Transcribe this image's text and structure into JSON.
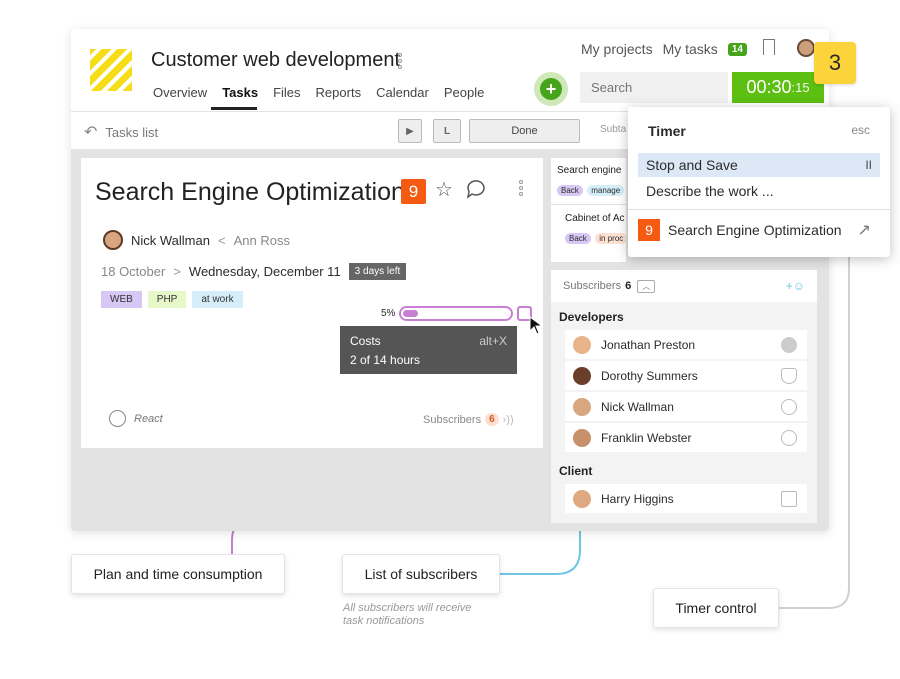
{
  "header": {
    "project_title": "Customer web development",
    "nav": [
      "Overview",
      "Tasks",
      "Files",
      "Reports",
      "Calendar",
      "People"
    ],
    "active_nav": "Tasks",
    "my_projects": "My projects",
    "my_tasks": "My tasks",
    "my_tasks_count": "14",
    "search_placeholder": "Search",
    "timer_main": "00:30",
    "timer_seconds": ":15"
  },
  "toolbar": {
    "back_label": "Tasks list",
    "play_label": "▶",
    "l_label": "L",
    "done_label": "Done",
    "subtasks_label": "Subta"
  },
  "task": {
    "title": "Search Engine Optimization",
    "number": "9",
    "assignee": "Nick Wallman",
    "separator": "<",
    "author": "Ann Ross",
    "start_date": "18 October",
    "arrow": ">",
    "due_date": "Wednesday, December 11",
    "days_left": "3 days left",
    "tags": [
      "WEB",
      "PHP",
      "at work"
    ],
    "progress_label": "5%",
    "progress": 0.14,
    "tooltip_title": "Costs",
    "tooltip_shortcut": "alt+X",
    "tooltip_value": "2 of 14 hours",
    "react_label": "React",
    "subscribers_label": "Subscribers",
    "subscribers_count": "6"
  },
  "related": {
    "item1_title": "Search engine",
    "item1_pills": [
      "Back",
      "manage"
    ],
    "item2_title": "Cabinet of Ac",
    "item2_pills": [
      "Back",
      "in proc"
    ]
  },
  "subscribers": {
    "label": "Subscribers",
    "count": "6",
    "groups": [
      {
        "title": "Developers",
        "people": [
          "Jonathan Preston",
          "Dorothy Summers",
          "Nick Wallman",
          "Franklin Webster"
        ]
      },
      {
        "title": "Client",
        "people": [
          "Harry Higgins"
        ]
      }
    ]
  },
  "timer_menu": {
    "title": "Timer",
    "esc": "esc",
    "stop_save": "Stop and Save",
    "pause_icon": "II",
    "describe": "Describe the work ...",
    "task_number": "9",
    "task_title": "Search Engine Optimization"
  },
  "step_number": "3",
  "callouts": {
    "plan": "Plan and time consumption",
    "subscribers": "List of subscribers",
    "subscribers_note_1": "All subscribers will receive",
    "subscribers_note_2": "task notifications",
    "timer": "Timer control"
  },
  "colors": {
    "accent_green": "#5cbf12",
    "task_badge": "#f45a11",
    "progress_purple": "#c580cf",
    "step_yellow": "#fbd33a",
    "link_blue": "#6ec5e8"
  }
}
